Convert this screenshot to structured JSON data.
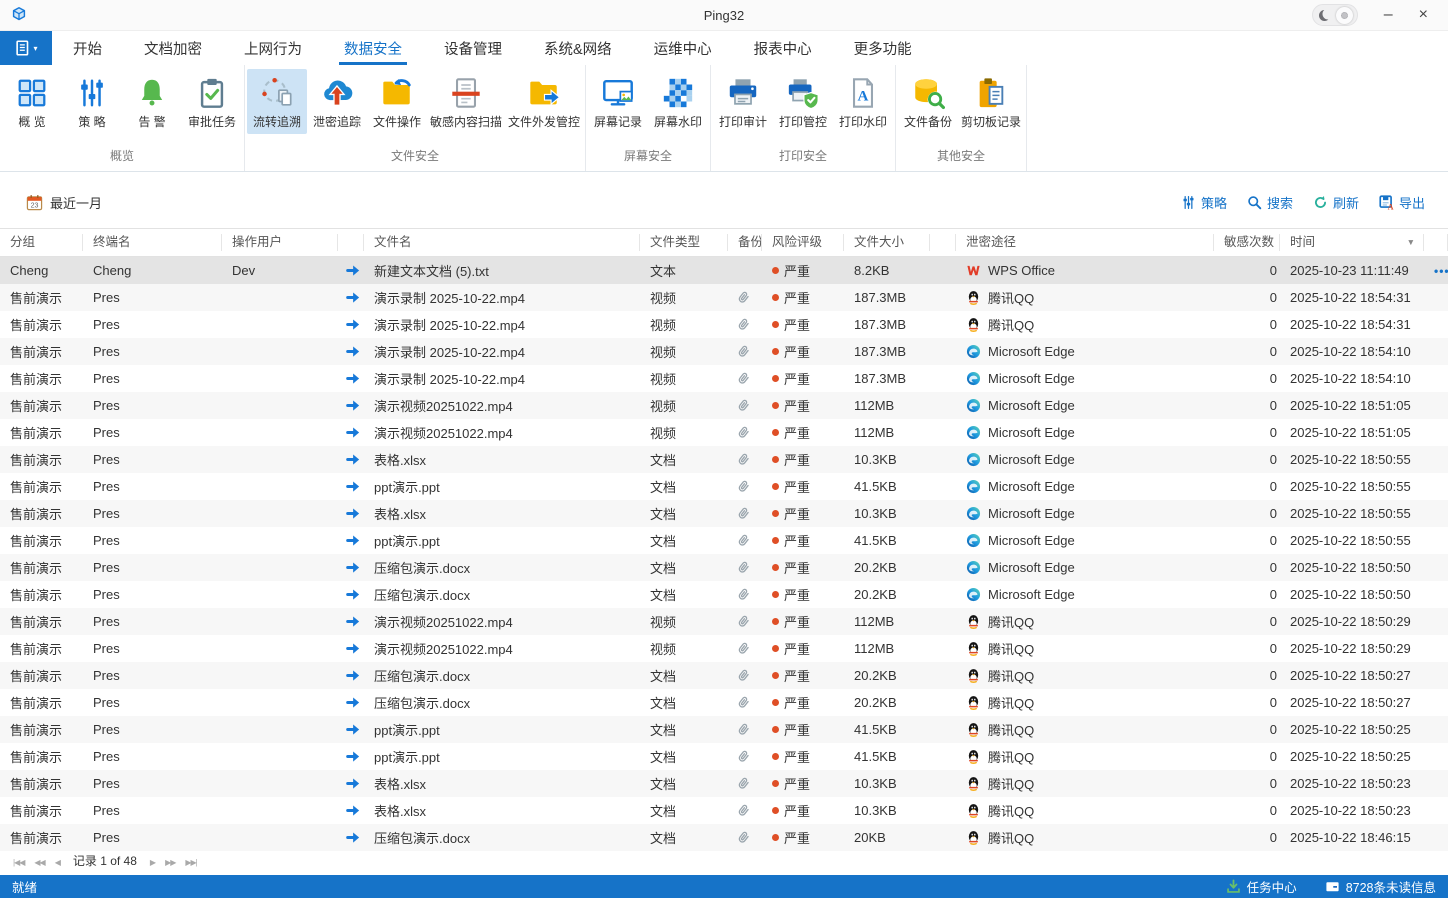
{
  "window": {
    "title": "Ping32"
  },
  "tabs": {
    "selected_index": 3,
    "items": [
      "开始",
      "文档加密",
      "上网行为",
      "数据安全",
      "设备管理",
      "系统&网络",
      "运维中心",
      "报表中心",
      "更多功能"
    ]
  },
  "ribbon": {
    "groups": [
      {
        "label": "概览",
        "buttons": [
          {
            "label": "概 览",
            "icon": "grid"
          },
          {
            "label": "策 略",
            "icon": "sliders"
          },
          {
            "label": "告 警",
            "icon": "bell"
          },
          {
            "label": "审批任务",
            "icon": "clipboard-check"
          }
        ]
      },
      {
        "label": "文件安全",
        "buttons": [
          {
            "label": "流转追溯",
            "icon": "trace",
            "selected": true
          },
          {
            "label": "泄密追踪",
            "icon": "cloud-up"
          },
          {
            "label": "文件操作",
            "icon": "folder-return"
          },
          {
            "label": "敏感内容扫描",
            "icon": "doc-scan"
          },
          {
            "label": "文件外发管控",
            "icon": "folder-out"
          }
        ]
      },
      {
        "label": "屏幕安全",
        "buttons": [
          {
            "label": "屏幕记录",
            "icon": "screen-record"
          },
          {
            "label": "屏幕水印",
            "icon": "screen-watermark"
          }
        ]
      },
      {
        "label": "打印安全",
        "buttons": [
          {
            "label": "打印审计",
            "icon": "printer"
          },
          {
            "label": "打印管控",
            "icon": "printer-shield"
          },
          {
            "label": "打印水印",
            "icon": "doc-a"
          }
        ]
      },
      {
        "label": "其他安全",
        "buttons": [
          {
            "label": "文件备份",
            "icon": "db-search"
          },
          {
            "label": "剪切板记录",
            "icon": "clipboard-doc"
          }
        ]
      }
    ]
  },
  "filterbar": {
    "date_range": "最近一月",
    "actions": [
      {
        "name": "policy",
        "icon": "sliders-sm",
        "label": "策略"
      },
      {
        "name": "search",
        "icon": "search",
        "label": "搜索"
      },
      {
        "name": "refresh",
        "icon": "refresh",
        "label": "刷新"
      },
      {
        "name": "export",
        "icon": "export",
        "label": "导出"
      }
    ]
  },
  "table": {
    "columns": [
      "分组",
      "终端名",
      "操作用户",
      "",
      "文件名",
      "文件类型",
      "备份",
      "风险评级",
      "文件大小",
      "",
      "泄密途径",
      "敏感次数",
      "时间",
      ""
    ],
    "rows": [
      {
        "selected": true,
        "group": "Cheng",
        "terminal": "Cheng",
        "user": "Dev",
        "file": "新建文本文档 (5).txt",
        "type": "文本",
        "backup": false,
        "risk": "严重",
        "size": "8.2KB",
        "app": "wps",
        "app_name": "WPS Office",
        "count": "0",
        "time": "2025-10-23 11:11:49",
        "more": "•••"
      },
      {
        "group": "售前演示",
        "terminal": "Pres",
        "user": "",
        "file": "演示录制 2025-10-22.mp4",
        "type": "视频",
        "backup": true,
        "risk": "严重",
        "size": "187.3MB",
        "app": "qq",
        "app_name": "腾讯QQ",
        "count": "0",
        "time": "2025-10-22 18:54:31"
      },
      {
        "group": "售前演示",
        "terminal": "Pres",
        "user": "",
        "file": "演示录制 2025-10-22.mp4",
        "type": "视频",
        "backup": true,
        "risk": "严重",
        "size": "187.3MB",
        "app": "qq",
        "app_name": "腾讯QQ",
        "count": "0",
        "time": "2025-10-22 18:54:31"
      },
      {
        "group": "售前演示",
        "terminal": "Pres",
        "user": "",
        "file": "演示录制 2025-10-22.mp4",
        "type": "视频",
        "backup": true,
        "risk": "严重",
        "size": "187.3MB",
        "app": "edge",
        "app_name": "Microsoft Edge",
        "count": "0",
        "time": "2025-10-22 18:54:10"
      },
      {
        "group": "售前演示",
        "terminal": "Pres",
        "user": "",
        "file": "演示录制 2025-10-22.mp4",
        "type": "视频",
        "backup": true,
        "risk": "严重",
        "size": "187.3MB",
        "app": "edge",
        "app_name": "Microsoft Edge",
        "count": "0",
        "time": "2025-10-22 18:54:10"
      },
      {
        "group": "售前演示",
        "terminal": "Pres",
        "user": "",
        "file": "演示视频20251022.mp4",
        "type": "视频",
        "backup": true,
        "risk": "严重",
        "size": "112MB",
        "app": "edge",
        "app_name": "Microsoft Edge",
        "count": "0",
        "time": "2025-10-22 18:51:05"
      },
      {
        "group": "售前演示",
        "terminal": "Pres",
        "user": "",
        "file": "演示视频20251022.mp4",
        "type": "视频",
        "backup": true,
        "risk": "严重",
        "size": "112MB",
        "app": "edge",
        "app_name": "Microsoft Edge",
        "count": "0",
        "time": "2025-10-22 18:51:05"
      },
      {
        "group": "售前演示",
        "terminal": "Pres",
        "user": "",
        "file": "表格.xlsx",
        "type": "文档",
        "backup": true,
        "risk": "严重",
        "size": "10.3KB",
        "app": "edge",
        "app_name": "Microsoft Edge",
        "count": "0",
        "time": "2025-10-22 18:50:55"
      },
      {
        "group": "售前演示",
        "terminal": "Pres",
        "user": "",
        "file": "ppt演示.ppt",
        "type": "文档",
        "backup": true,
        "risk": "严重",
        "size": "41.5KB",
        "app": "edge",
        "app_name": "Microsoft Edge",
        "count": "0",
        "time": "2025-10-22 18:50:55"
      },
      {
        "group": "售前演示",
        "terminal": "Pres",
        "user": "",
        "file": "表格.xlsx",
        "type": "文档",
        "backup": true,
        "risk": "严重",
        "size": "10.3KB",
        "app": "edge",
        "app_name": "Microsoft Edge",
        "count": "0",
        "time": "2025-10-22 18:50:55"
      },
      {
        "group": "售前演示",
        "terminal": "Pres",
        "user": "",
        "file": "ppt演示.ppt",
        "type": "文档",
        "backup": true,
        "risk": "严重",
        "size": "41.5KB",
        "app": "edge",
        "app_name": "Microsoft Edge",
        "count": "0",
        "time": "2025-10-22 18:50:55"
      },
      {
        "group": "售前演示",
        "terminal": "Pres",
        "user": "",
        "file": "压缩包演示.docx",
        "type": "文档",
        "backup": true,
        "risk": "严重",
        "size": "20.2KB",
        "app": "edge",
        "app_name": "Microsoft Edge",
        "count": "0",
        "time": "2025-10-22 18:50:50"
      },
      {
        "group": "售前演示",
        "terminal": "Pres",
        "user": "",
        "file": "压缩包演示.docx",
        "type": "文档",
        "backup": true,
        "risk": "严重",
        "size": "20.2KB",
        "app": "edge",
        "app_name": "Microsoft Edge",
        "count": "0",
        "time": "2025-10-22 18:50:50"
      },
      {
        "group": "售前演示",
        "terminal": "Pres",
        "user": "",
        "file": "演示视频20251022.mp4",
        "type": "视频",
        "backup": true,
        "risk": "严重",
        "size": "112MB",
        "app": "qq",
        "app_name": "腾讯QQ",
        "count": "0",
        "time": "2025-10-22 18:50:29"
      },
      {
        "group": "售前演示",
        "terminal": "Pres",
        "user": "",
        "file": "演示视频20251022.mp4",
        "type": "视频",
        "backup": true,
        "risk": "严重",
        "size": "112MB",
        "app": "qq",
        "app_name": "腾讯QQ",
        "count": "0",
        "time": "2025-10-22 18:50:29"
      },
      {
        "group": "售前演示",
        "terminal": "Pres",
        "user": "",
        "file": "压缩包演示.docx",
        "type": "文档",
        "backup": true,
        "risk": "严重",
        "size": "20.2KB",
        "app": "qq",
        "app_name": "腾讯QQ",
        "count": "0",
        "time": "2025-10-22 18:50:27"
      },
      {
        "group": "售前演示",
        "terminal": "Pres",
        "user": "",
        "file": "压缩包演示.docx",
        "type": "文档",
        "backup": true,
        "risk": "严重",
        "size": "20.2KB",
        "app": "qq",
        "app_name": "腾讯QQ",
        "count": "0",
        "time": "2025-10-22 18:50:27"
      },
      {
        "group": "售前演示",
        "terminal": "Pres",
        "user": "",
        "file": "ppt演示.ppt",
        "type": "文档",
        "backup": true,
        "risk": "严重",
        "size": "41.5KB",
        "app": "qq",
        "app_name": "腾讯QQ",
        "count": "0",
        "time": "2025-10-22 18:50:25"
      },
      {
        "group": "售前演示",
        "terminal": "Pres",
        "user": "",
        "file": "ppt演示.ppt",
        "type": "文档",
        "backup": true,
        "risk": "严重",
        "size": "41.5KB",
        "app": "qq",
        "app_name": "腾讯QQ",
        "count": "0",
        "time": "2025-10-22 18:50:25"
      },
      {
        "group": "售前演示",
        "terminal": "Pres",
        "user": "",
        "file": "表格.xlsx",
        "type": "文档",
        "backup": true,
        "risk": "严重",
        "size": "10.3KB",
        "app": "qq",
        "app_name": "腾讯QQ",
        "count": "0",
        "time": "2025-10-22 18:50:23"
      },
      {
        "group": "售前演示",
        "terminal": "Pres",
        "user": "",
        "file": "表格.xlsx",
        "type": "文档",
        "backup": true,
        "risk": "严重",
        "size": "10.3KB",
        "app": "qq",
        "app_name": "腾讯QQ",
        "count": "0",
        "time": "2025-10-22 18:50:23"
      },
      {
        "group": "售前演示",
        "terminal": "Pres",
        "user": "",
        "file": "压缩包演示.docx",
        "type": "文档",
        "backup": true,
        "risk": "严重",
        "size": "20KB",
        "app": "qq",
        "app_name": "腾讯QQ",
        "count": "0",
        "time": "2025-10-22 18:46:15"
      }
    ]
  },
  "pagination": {
    "label": "记录 1 of 48"
  },
  "statusbar": {
    "ready": "就绪",
    "task_center": "任务中心",
    "unread": "8728条未读信息"
  }
}
